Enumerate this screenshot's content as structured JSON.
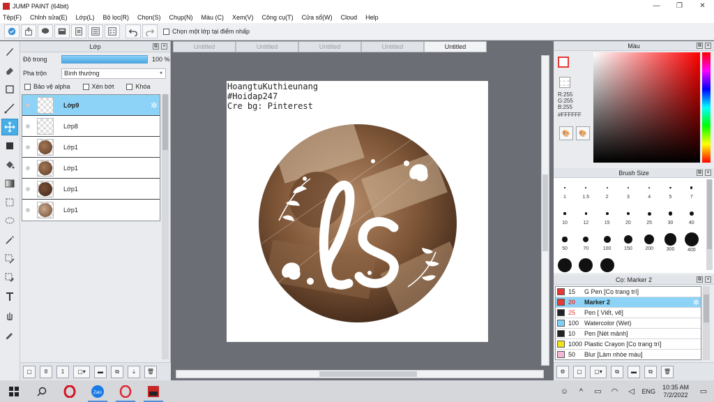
{
  "window": {
    "title": "JUMP PAINT (64bit)"
  },
  "menu": [
    "Tệp(F)",
    "Chỉnh sửa(E)",
    "Lớp(L)",
    "Bộ lọc(R)",
    "Chọn(S)",
    "Chụp(N)",
    "Màu (C)",
    "Xem(V)",
    "Công cụ(T)",
    "Cửa sổ(W)",
    "Cloud",
    "Help"
  ],
  "toolbar": {
    "select_layer_label": "Chọn một lớp tại điểm nhấp"
  },
  "layer_panel": {
    "title": "Lớp",
    "opacity_label": "Độ trong",
    "opacity_value": "100 %",
    "opacity_fraction": 1.0,
    "blend_label": "Pha trộn",
    "blend_value": "Bình thường",
    "protect_alpha": "Bảo vệ alpha",
    "clipping": "Xén bớt",
    "lock": "Khóa",
    "layers": [
      {
        "name": "Lớp9",
        "selected": true,
        "thumb": "empty"
      },
      {
        "name": "Lớp8",
        "selected": false,
        "thumb": "empty"
      },
      {
        "name": "Lớp1",
        "selected": false,
        "thumb": "image"
      },
      {
        "name": "Lớp1",
        "selected": false,
        "thumb": "image"
      },
      {
        "name": "Lớp1",
        "selected": false,
        "thumb": "image"
      },
      {
        "name": "Lớp1",
        "selected": false,
        "thumb": "image"
      }
    ]
  },
  "tabs": [
    {
      "label": "Untitled",
      "active": false
    },
    {
      "label": "Untitled",
      "active": false
    },
    {
      "label": "Untitled",
      "active": false
    },
    {
      "label": "Untitled",
      "active": false
    },
    {
      "label": "Untitled",
      "active": true
    }
  ],
  "canvas": {
    "credit_lines": [
      "HoangtuKuthieunang",
      "#Hoidap247",
      "Cre bg: Pinterest"
    ]
  },
  "color_panel": {
    "title": "Màu",
    "r": "R:255",
    "g": "G:255",
    "b": "B:255",
    "hex": "#FFFFFF",
    "fg_color": "#e53935"
  },
  "brush_panel": {
    "title": "Brush Size",
    "sizes": [
      "1",
      "1.5",
      "2",
      "3",
      "4",
      "5",
      "7",
      "10",
      "12",
      "15",
      "20",
      "25",
      "30",
      "40",
      "50",
      "70",
      "100",
      "150",
      "200",
      "300",
      "400",
      "",
      "",
      ""
    ]
  },
  "tool_panel": {
    "title": "Cọ: Marker 2",
    "items": [
      {
        "size": "15",
        "name": "G Pen [Cọ trang trí]",
        "color": "#e53935",
        "selected": false,
        "size_color": "#222"
      },
      {
        "size": "20",
        "name": "Marker 2",
        "color": "#e53935",
        "selected": true,
        "size_color": "#e53935"
      },
      {
        "size": "25",
        "name": "Pen [ Viết, vẽ]",
        "color": "#222222",
        "selected": false,
        "size_color": "#e53935"
      },
      {
        "size": "100",
        "name": "Watercolor (Wet)",
        "color": "#7fd0f4",
        "selected": false,
        "size_color": "#222"
      },
      {
        "size": "10",
        "name": "Pen [Nét mảnh]",
        "color": "#222222",
        "selected": false,
        "size_color": "#222"
      },
      {
        "size": "1000",
        "name": "Plastic Crayon [Cọ trang trí]",
        "color": "#f2e21a",
        "selected": false,
        "size_color": "#222"
      },
      {
        "size": "50",
        "name": "Blur [Làm nhòe màu]",
        "color": "#f5b7d6",
        "selected": false,
        "size_color": "#222"
      }
    ]
  },
  "taskbar": {
    "lang": "ENG",
    "time": "10:35 AM",
    "date": "7/2/2022"
  }
}
